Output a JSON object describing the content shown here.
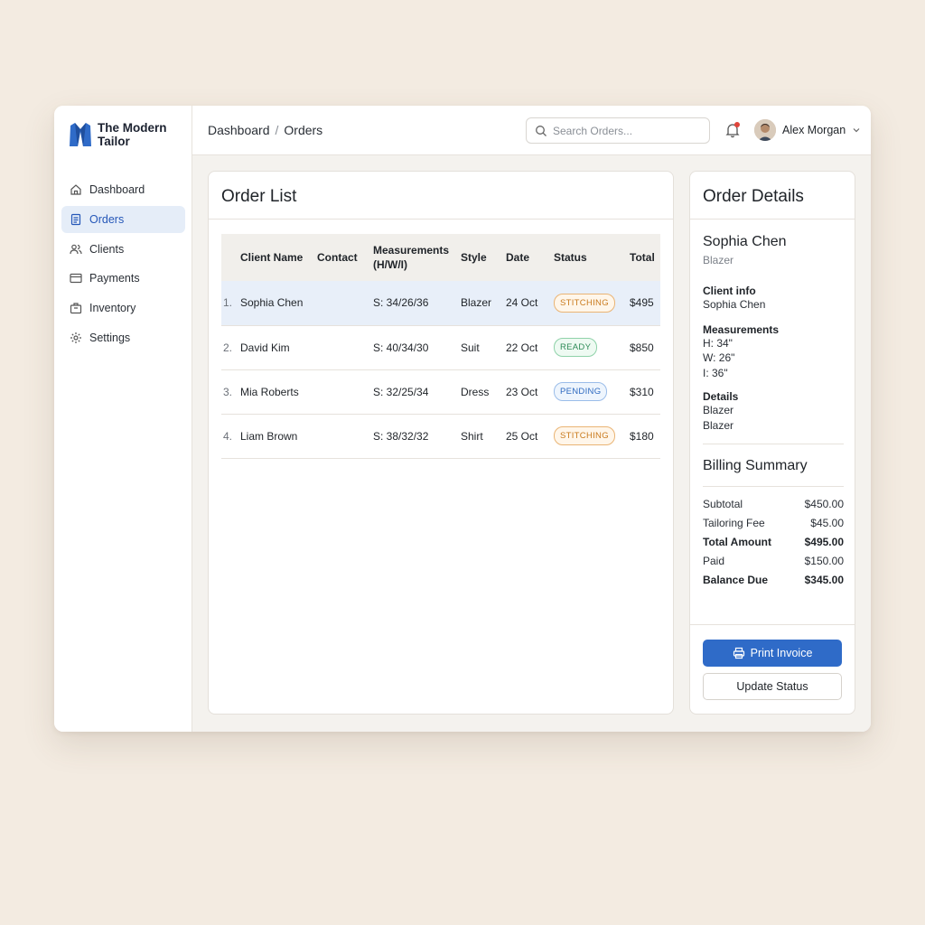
{
  "brand": {
    "name": "The Modern Tailor",
    "logo_icon": "suit-jacket-icon",
    "accent": "#2f6bc8"
  },
  "sidebar": {
    "items": [
      {
        "label": "Dashboard",
        "icon": "home-icon",
        "active": false
      },
      {
        "label": "Orders",
        "icon": "document-icon",
        "active": true
      },
      {
        "label": "Clients",
        "icon": "users-icon",
        "active": false
      },
      {
        "label": "Payments",
        "icon": "credit-card-icon",
        "active": false
      },
      {
        "label": "Inventory",
        "icon": "box-icon",
        "active": false
      },
      {
        "label": "Settings",
        "icon": "gear-icon",
        "active": false
      }
    ]
  },
  "header": {
    "breadcrumb": [
      "Dashboard",
      "Orders"
    ],
    "breadcrumb_sep": "/",
    "search_placeholder": "Search Orders...",
    "user_name": "Alex Morgan"
  },
  "orders": {
    "title": "Order List",
    "columns": [
      "Client Name",
      "Contact",
      "Measurements (H/W/I)",
      "Style",
      "Date",
      "Status",
      "Total"
    ],
    "rows": [
      {
        "num": "1.",
        "client": "Sophia Chen",
        "contact": "",
        "measurements": "S: 34/26/36",
        "style": "Blazer",
        "date": "24 Oct",
        "status": "STITCHING",
        "status_kind": "stitching",
        "total": "$495",
        "selected": true
      },
      {
        "num": "2.",
        "client": "David Kim",
        "contact": "",
        "measurements": "S: 40/34/30",
        "style": "Suit",
        "date": "22 Oct",
        "status": "READY",
        "status_kind": "ready",
        "total": "$850",
        "selected": false
      },
      {
        "num": "3.",
        "client": "Mia Roberts",
        "contact": "",
        "measurements": "S: 32/25/34",
        "style": "Dress",
        "date": "23 Oct",
        "status": "PENDING",
        "status_kind": "pending",
        "total": "$310",
        "selected": false
      },
      {
        "num": "4.",
        "client": "Liam Brown",
        "contact": "",
        "measurements": "S: 38/32/32",
        "style": "Shirt",
        "date": "25 Oct",
        "status": "STITCHING",
        "status_kind": "stitching",
        "total": "$180",
        "selected": false
      }
    ]
  },
  "details": {
    "title": "Order Details",
    "name": "Sophia Chen",
    "style": "Blazer",
    "client_info_label": "Client info",
    "client_info_value": "Sophia Chen",
    "measurements_label": "Measurements",
    "measurements": [
      "H: 34\"",
      "W: 26\"",
      "I: 36\""
    ],
    "details_label": "Details",
    "details_values": [
      "Blazer",
      "Blazer"
    ],
    "billing_title": "Billing Summary",
    "billing": [
      {
        "label": "Subtotal",
        "value": "$450.00",
        "bold": false
      },
      {
        "label": "Tailoring Fee",
        "value": "$45.00",
        "bold": false
      },
      {
        "label": "Total Amount",
        "value": "$495.00",
        "bold": true
      },
      {
        "label": "Paid",
        "value": "$150.00",
        "bold": false
      },
      {
        "label": "Balance Due",
        "value": "$345.00",
        "bold": true
      }
    ],
    "print_label": "Print Invoice",
    "update_label": "Update Status"
  }
}
